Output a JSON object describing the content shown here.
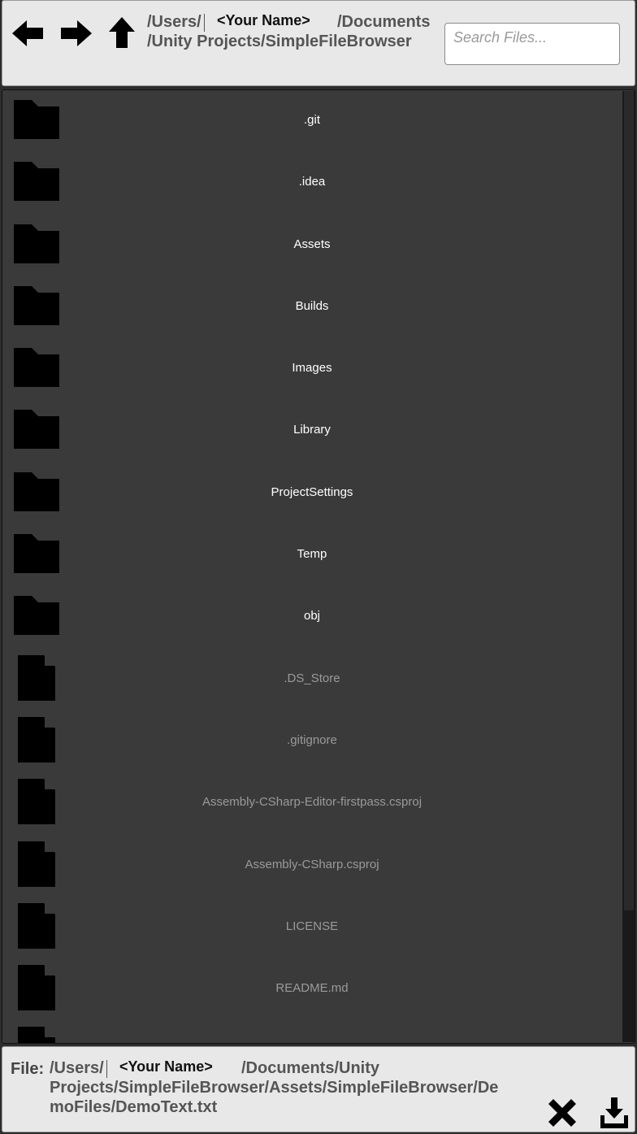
{
  "toolbar": {
    "back_icon": "arrow-left-icon",
    "forward_icon": "arrow-right-icon",
    "up_icon": "arrow-up-icon"
  },
  "path": {
    "users": "/Users/",
    "user_name": "<Your Name>",
    "documents": "/Documents",
    "line2": "/Unity Projects/SimpleFileBrowser"
  },
  "search": {
    "placeholder": "Search Files..."
  },
  "items": [
    {
      "name": ".git",
      "type": "folder"
    },
    {
      "name": ".idea",
      "type": "folder"
    },
    {
      "name": "Assets",
      "type": "folder"
    },
    {
      "name": "Builds",
      "type": "folder"
    },
    {
      "name": "Images",
      "type": "folder"
    },
    {
      "name": "Library",
      "type": "folder"
    },
    {
      "name": "ProjectSettings",
      "type": "folder"
    },
    {
      "name": "Temp",
      "type": "folder"
    },
    {
      "name": "obj",
      "type": "folder"
    },
    {
      "name": ".DS_Store",
      "type": "file"
    },
    {
      "name": ".gitignore",
      "type": "file"
    },
    {
      "name": "Assembly-CSharp-Editor-firstpass.csproj",
      "type": "file"
    },
    {
      "name": "Assembly-CSharp.csproj",
      "type": "file"
    },
    {
      "name": "LICENSE",
      "type": "file"
    },
    {
      "name": "README.md",
      "type": "file"
    },
    {
      "name": "",
      "type": "file"
    }
  ],
  "footer": {
    "file_label": "File:",
    "users": "/Users/",
    "user_name": "<Your Name>",
    "line1_rest": "/Documents/Unity",
    "line2": "Projects/SimpleFileBrowser/Assets/SimpleFileBrowser/De",
    "line3": "moFiles/DemoText.txt",
    "cancel_icon": "close-icon",
    "save_icon": "download-icon"
  },
  "colors": {
    "panel_bg": "#3a3a3a",
    "bar_bg": "#e8e8e8",
    "folder_text": "#ffffff",
    "file_text": "#9a9a9a"
  }
}
